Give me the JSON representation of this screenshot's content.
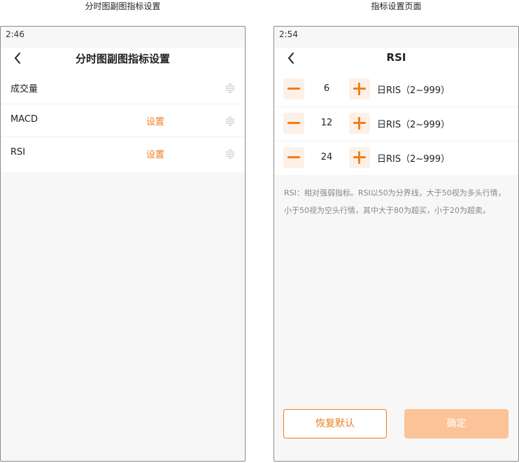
{
  "captions": {
    "left": "分时图副图指标设置",
    "right": "指标设置页面"
  },
  "left_screen": {
    "status_time": "2:46",
    "title": "分时图副图指标设置",
    "rows": [
      {
        "label": "成交量",
        "setting": ""
      },
      {
        "label": "MACD",
        "setting": "设置"
      },
      {
        "label": "RSI",
        "setting": "设置"
      }
    ]
  },
  "right_screen": {
    "status_time": "2:54",
    "title": "RSI",
    "params": [
      {
        "value": "6",
        "label": "日RIS（2~999）"
      },
      {
        "value": "12",
        "label": "日RIS（2~999）"
      },
      {
        "value": "24",
        "label": "日RIS（2~999）"
      }
    ],
    "description": "RSI：相对强弱指标。RSI以50为分界线，大于50视为多头行情，小于50视为空头行情，其中大于80为超买，小于20为超卖。",
    "reset_label": "恢复默认",
    "confirm_label": "确定"
  },
  "colors": {
    "accent": "#f07e1e",
    "accent_light": "#fdf0e6",
    "confirm_bg": "#fbc397",
    "background": "#f7f7f7"
  },
  "icons": {
    "back": "chevron-left-icon",
    "drag": "drag-handle-icon",
    "minus": "minus-icon",
    "plus": "plus-icon"
  }
}
